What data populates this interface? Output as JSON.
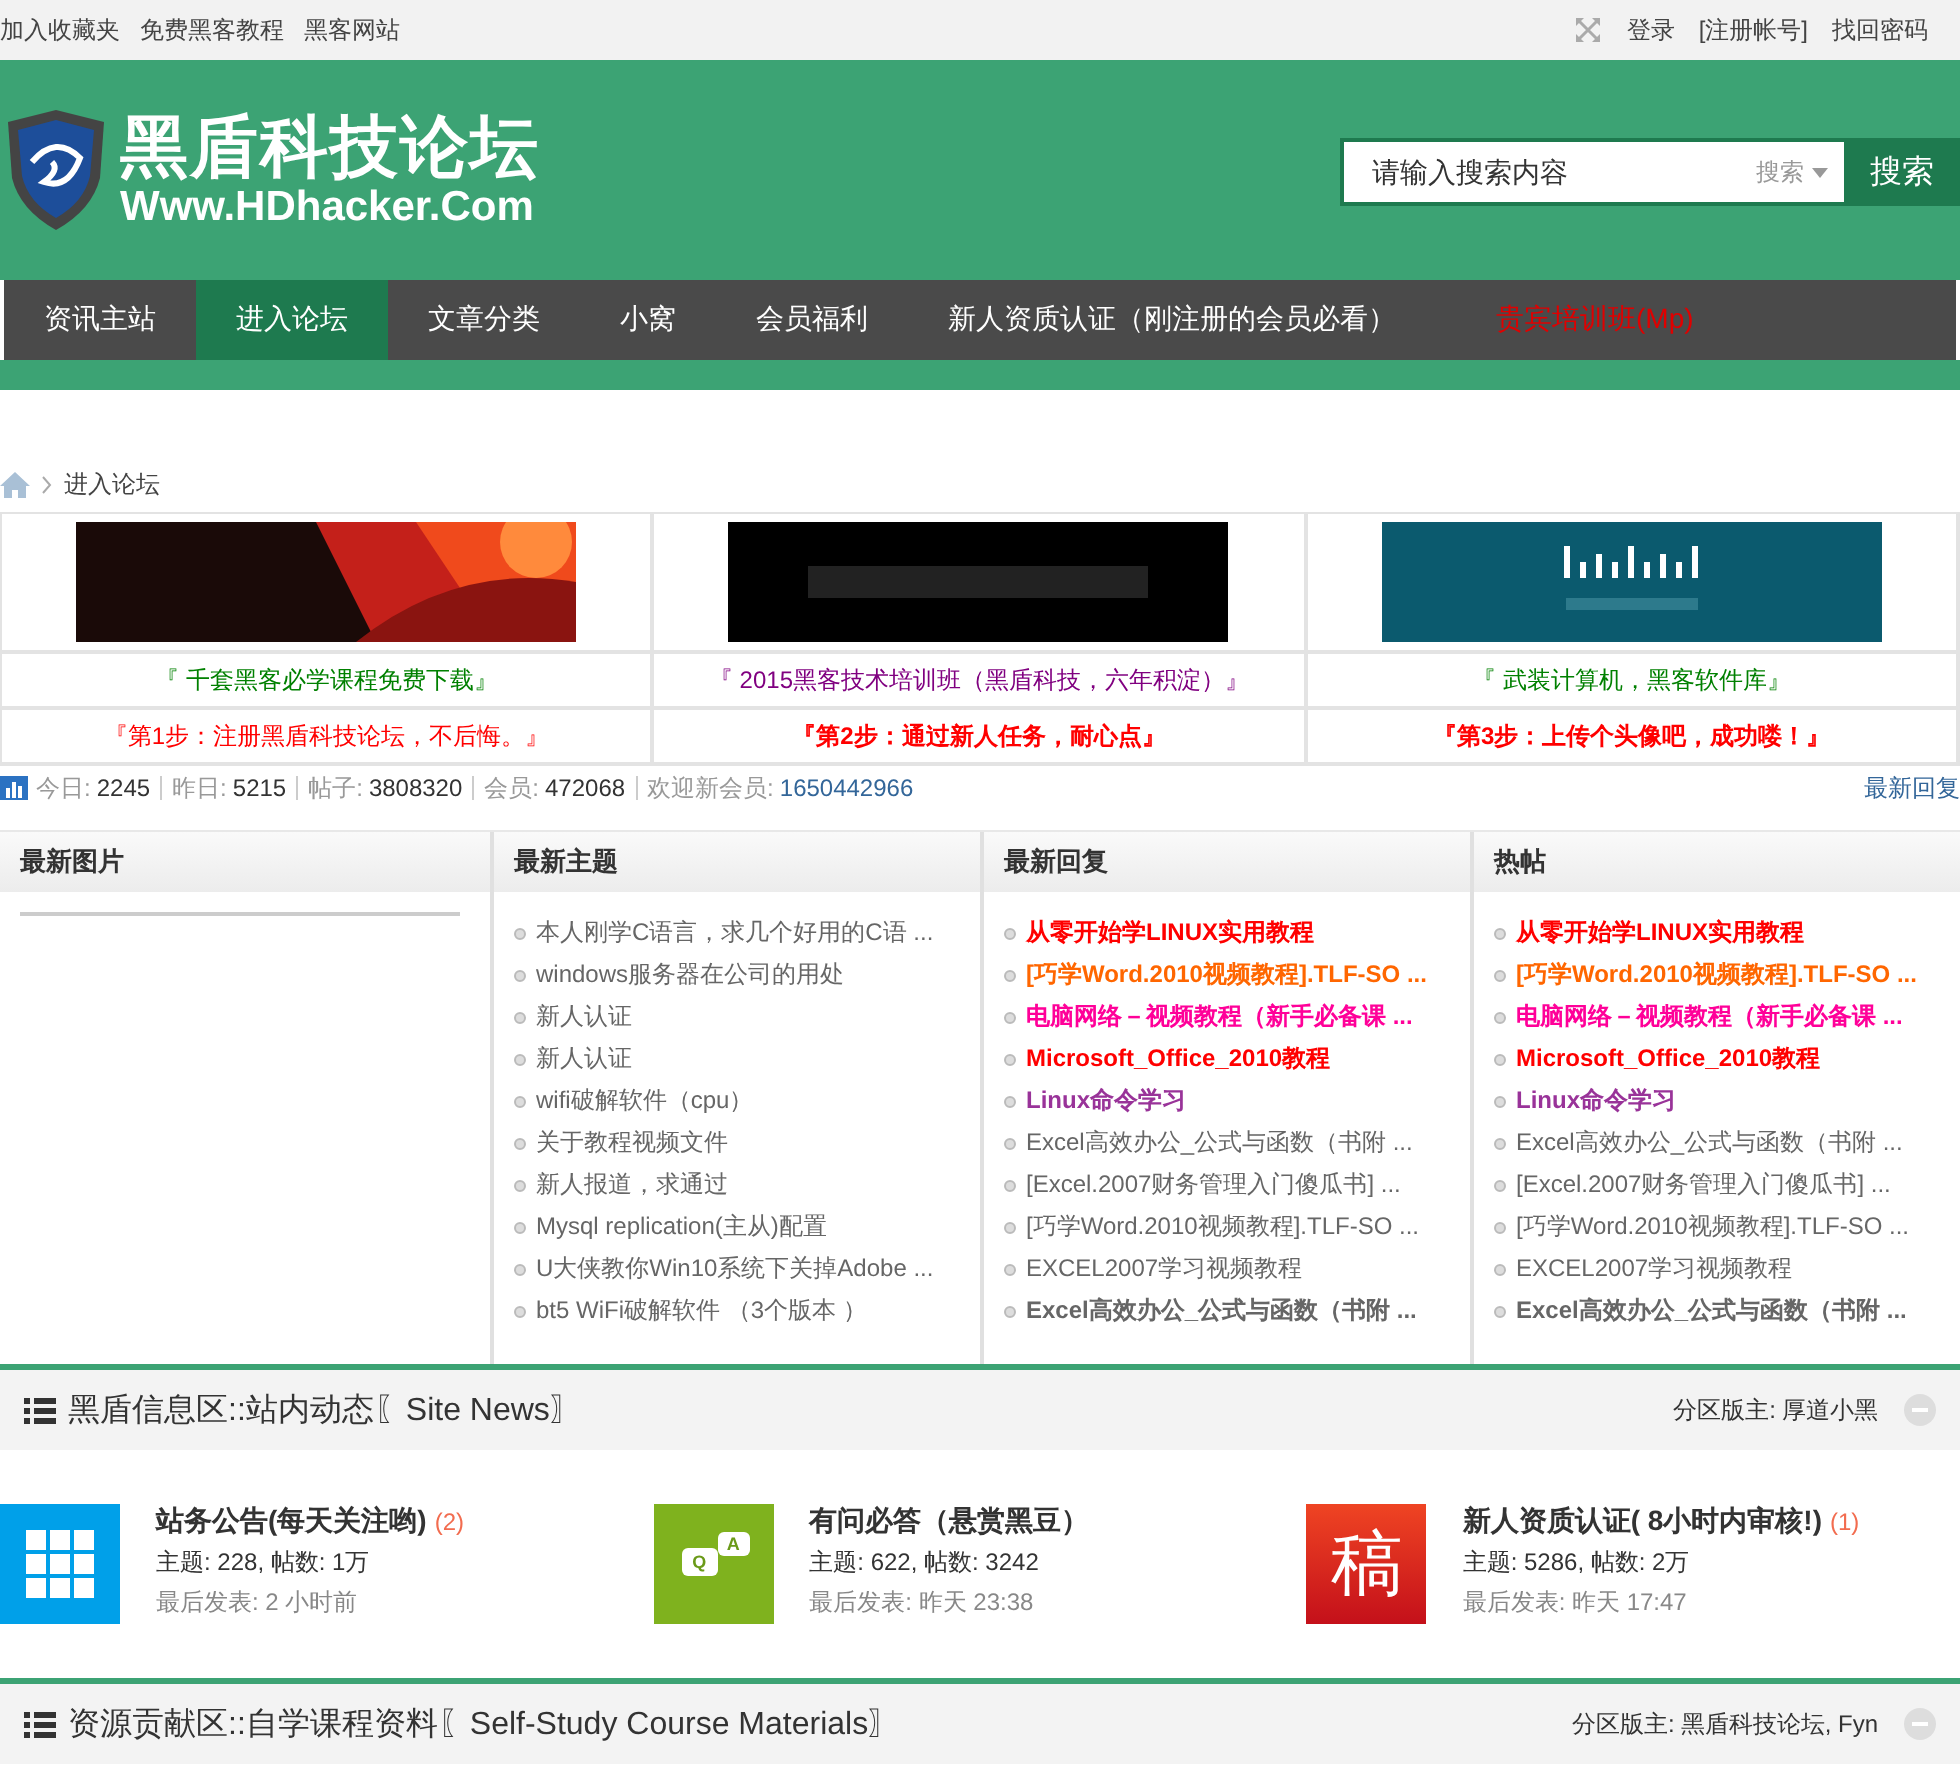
{
  "top_links": [
    "加入收藏夹",
    "免费黑客教程",
    "黑客网站"
  ],
  "top_right": [
    "登录",
    "[注册帐号]",
    "找回密码"
  ],
  "logo": {
    "title": "黑盾科技论坛",
    "subtitle": "Www.HDhacker.Com"
  },
  "search": {
    "placeholder": "请输入搜索内容",
    "scope": "搜索",
    "button": "搜索"
  },
  "nav": [
    {
      "label": "资讯主站",
      "selected": false,
      "highlight": false
    },
    {
      "label": "进入论坛",
      "selected": true,
      "highlight": false
    },
    {
      "label": "文章分类",
      "selected": false,
      "highlight": false
    },
    {
      "label": "小窝",
      "selected": false,
      "highlight": false
    },
    {
      "label": "会员福利",
      "selected": false,
      "highlight": false
    },
    {
      "label": "新人资质认证（刚注册的会员必看）",
      "selected": false,
      "highlight": false
    },
    {
      "label": "贵宾培训班(Mp)",
      "selected": false,
      "highlight": true
    }
  ],
  "breadcrumb": "进入论坛",
  "banners": [
    {
      "kind": "picture",
      "link": "『 千套黑客必学课程免费下载』",
      "color": "#008000",
      "step": "『第1步：注册黑盾科技论坛，不后悔。』",
      "step_bold": false
    },
    {
      "kind": "picture",
      "link": "『 2015黑客技术培训班（黑盾科技，六年积淀）』",
      "color": "#800080",
      "step": "『第2步：通过新人任务，耐心点』",
      "step_bold": true
    },
    {
      "kind": "picture",
      "link": "『 武装计算机，黑客软件库』",
      "color": "#008000",
      "step": "『第3步：上传个头像吧，成功喽！』",
      "step_bold": true
    }
  ],
  "stats": [
    {
      "label": "今日:",
      "value": "2245"
    },
    {
      "label": "昨日:",
      "value": "5215"
    },
    {
      "label": "帖子:",
      "value": "3808320"
    },
    {
      "label": "会员:",
      "value": "472068"
    }
  ],
  "welcome": {
    "label": "欢迎新会员:",
    "user": "1650442966"
  },
  "latest_replies_link": "最新回复",
  "columns": [
    {
      "title": "最新图片"
    },
    {
      "title": "最新主题",
      "items": [
        {
          "text": "本人刚学C语言，求几个好用的C语 ...",
          "color": "#666666",
          "bold": false
        },
        {
          "text": "windows服务器在公司的用处",
          "color": "#666666",
          "bold": false
        },
        {
          "text": "新人认证",
          "color": "#666666",
          "bold": false
        },
        {
          "text": "新人认证",
          "color": "#666666",
          "bold": false
        },
        {
          "text": "wifi破解软件（cpu）",
          "color": "#666666",
          "bold": false
        },
        {
          "text": "关于教程视频文件",
          "color": "#666666",
          "bold": false
        },
        {
          "text": "新人报道，求通过",
          "color": "#666666",
          "bold": false
        },
        {
          "text": "Mysql replication(主从)配置",
          "color": "#666666",
          "bold": false
        },
        {
          "text": "U大侠教你Win10系统下关掉Adobe ...",
          "color": "#666666",
          "bold": false
        },
        {
          "text": "bt5 WiFi破解软件 （3个版本 ）",
          "color": "#666666",
          "bold": false
        }
      ]
    },
    {
      "title": "最新回复",
      "items": [
        {
          "text": "从零开始学LINUX实用教程",
          "color": "#ff0000",
          "bold": true
        },
        {
          "text": "[巧学Word.2010视频教程].TLF-SO ...",
          "color": "#ff6600",
          "bold": true
        },
        {
          "text": "电脑网络－视频教程（新手必备课 ...",
          "color": "#ff0099",
          "bold": true
        },
        {
          "text": "Microsoft_Office_2010教程",
          "color": "#ff0000",
          "bold": true
        },
        {
          "text": "Linux命令学习",
          "color": "#993399",
          "bold": true
        },
        {
          "text": "Excel高效办公_公式与函数（书附 ...",
          "color": "#666666",
          "bold": false
        },
        {
          "text": "[Excel.2007财务管理入门傻瓜书] ...",
          "color": "#666666",
          "bold": false
        },
        {
          "text": "[巧学Word.2010视频教程].TLF-SO ...",
          "color": "#666666",
          "bold": false
        },
        {
          "text": "EXCEL2007学习视频教程",
          "color": "#666666",
          "bold": false
        },
        {
          "text": "Excel高效办公_公式与函数（书附 ...",
          "color": "#666666",
          "bold": true
        }
      ]
    },
    {
      "title": "热帖",
      "items": [
        {
          "text": "从零开始学LINUX实用教程",
          "color": "#ff0000",
          "bold": true
        },
        {
          "text": "[巧学Word.2010视频教程].TLF-SO ...",
          "color": "#ff6600",
          "bold": true
        },
        {
          "text": "电脑网络－视频教程（新手必备课 ...",
          "color": "#ff0099",
          "bold": true
        },
        {
          "text": "Microsoft_Office_2010教程",
          "color": "#ff0000",
          "bold": true
        },
        {
          "text": "Linux命令学习",
          "color": "#993399",
          "bold": true
        },
        {
          "text": "Excel高效办公_公式与函数（书附 ...",
          "color": "#666666",
          "bold": false
        },
        {
          "text": "[Excel.2007财务管理入门傻瓜书] ...",
          "color": "#666666",
          "bold": false
        },
        {
          "text": "[巧学Word.2010视频教程].TLF-SO ...",
          "color": "#666666",
          "bold": false
        },
        {
          "text": "EXCEL2007学习视频教程",
          "color": "#666666",
          "bold": false
        },
        {
          "text": "Excel高效办公_公式与函数（书附 ...",
          "color": "#666666",
          "bold": true
        }
      ]
    }
  ],
  "sections": [
    {
      "title": "黑盾信息区::站内动态〖Site News〗",
      "moderator_label": "分区版主:",
      "moderator": "厚道小黑",
      "forums": [
        {
          "kind": "grid",
          "name": "站务公告(每天关注哟)",
          "new_count": "(2)",
          "stats": "主题: 228, 帖数: 1万",
          "last_post": "最后发表: 2 小时前"
        },
        {
          "kind": "qa",
          "q": "Q",
          "a": "A",
          "name": "有问必答（悬赏黑豆）",
          "stats": "主题: 622, 帖数: 3242",
          "last_post": "最后发表: 昨天 23:38"
        },
        {
          "kind": "char",
          "char": "稿",
          "name": "新人资质认证( 8小时内审核!)",
          "new_count": "(1)",
          "stats": "主题: 5286, 帖数: 2万",
          "last_post": "最后发表: 昨天 17:47"
        }
      ]
    },
    {
      "title": "资源贡献区::自学课程资料〖Self-Study Course Materials〗",
      "moderator_label": "分区版主:",
      "moderator": "黑盾科技论坛, Fyn"
    }
  ]
}
